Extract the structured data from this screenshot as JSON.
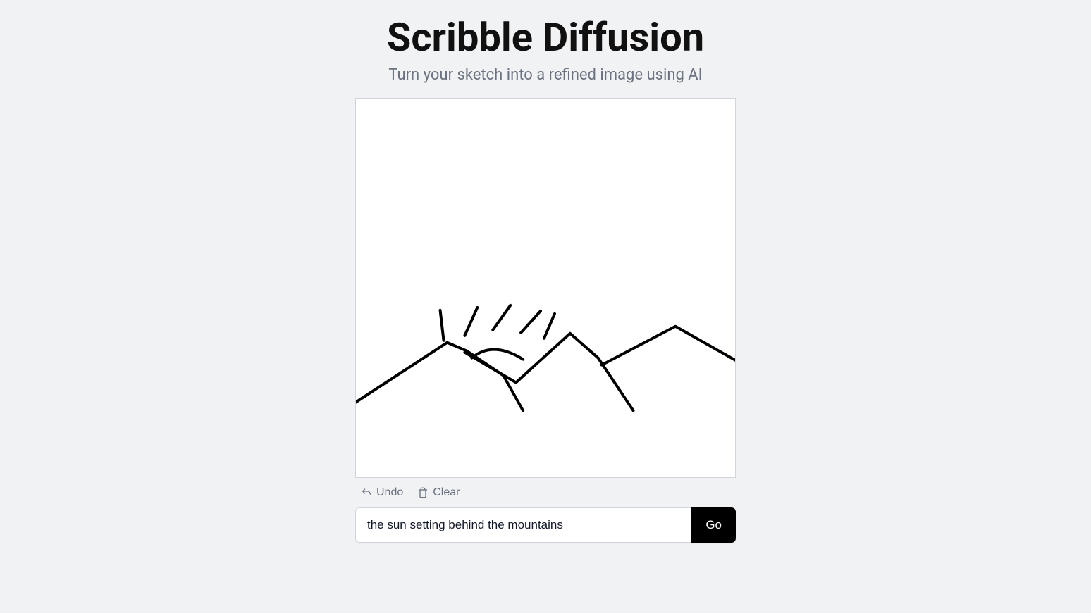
{
  "header": {
    "title": "Scribble Diffusion",
    "subtitle": "Turn your sketch into a refined image using AI"
  },
  "controls": {
    "undo_label": "Undo",
    "clear_label": "Clear"
  },
  "prompt": {
    "value": "the sun setting behind the mountains",
    "go_label": "Go"
  }
}
